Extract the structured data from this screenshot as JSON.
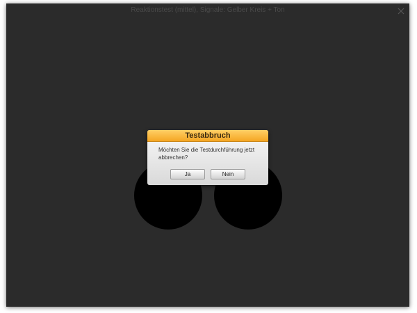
{
  "window": {
    "title": "Reaktionstest (mittel), Signale: Gelber Kreis + Ton",
    "close_icon": "close-icon"
  },
  "stimulus": {
    "circle_color": "#000000",
    "background_color": "#2b2b2b"
  },
  "dialog": {
    "title": "Testabbruch",
    "message": "Möchten Sie die Testdurchführung jetzt abbrechen?",
    "buttons": {
      "yes": "Ja",
      "no": "Nein"
    },
    "header_color": "#f5a623"
  }
}
